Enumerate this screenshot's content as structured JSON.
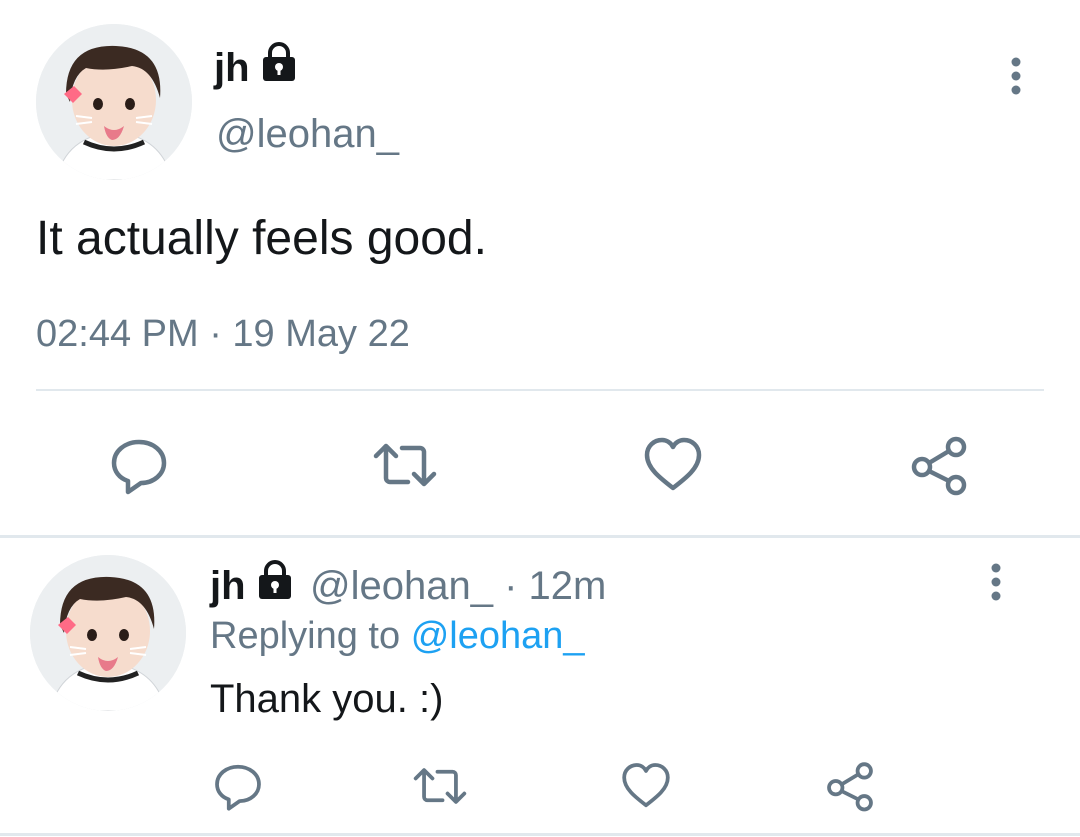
{
  "tweet": {
    "display_name": "jh",
    "handle": "@leohan_",
    "text": "It actually feels good.",
    "timestamp": "02:44 PM · 19 May 22",
    "actions": [
      "reply-icon",
      "retweet-icon",
      "like-icon",
      "share-icon"
    ]
  },
  "reply": {
    "display_name": "jh",
    "meta": "@leohan_ · 12m",
    "replying_prefix": "Replying to",
    "replying_mention": "@leohan_",
    "text": "Thank you. :)",
    "actions": [
      "reply-icon",
      "retweet-icon",
      "like-icon",
      "share-icon"
    ]
  },
  "colors": {
    "text": "#14171a",
    "muted": "#657786",
    "link": "#1da1f2",
    "divider": "#e1e8ed"
  }
}
